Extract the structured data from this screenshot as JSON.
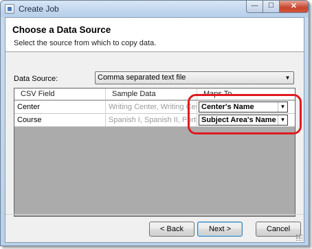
{
  "window": {
    "title": "Create Job",
    "close_glyph": "✕",
    "minimize_glyph": "—",
    "maximize_glyph": "☐"
  },
  "header": {
    "title": "Choose a Data Source",
    "subtitle": "Select the source from which to copy data."
  },
  "data_source": {
    "label": "Data Source:",
    "selected": "Comma separated text file"
  },
  "grid": {
    "columns": [
      "CSV Field",
      "Sample Data",
      "Maps To"
    ],
    "rows": [
      {
        "field": "Center",
        "sample": "Writing Center, Writing Center...",
        "maps_to": "Center's Name"
      },
      {
        "field": "Course",
        "sample": "Spanish I, Spanish II, Portugu...",
        "maps_to": "Subject Area's Name"
      }
    ]
  },
  "buttons": {
    "back": "< Back",
    "next": "Next >",
    "cancel": "Cancel"
  },
  "icons": {
    "dropdown_arrow": "▼"
  },
  "colors": {
    "highlight": "#e0191f",
    "close_button": "#c8452d"
  }
}
